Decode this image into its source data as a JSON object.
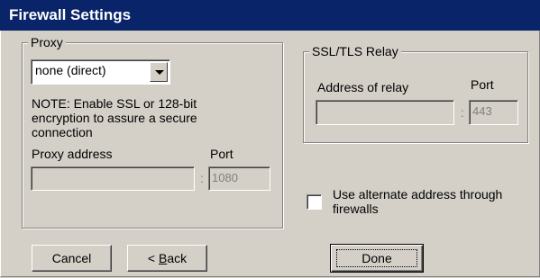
{
  "window": {
    "title": "Firewall Settings"
  },
  "proxy": {
    "legend": "Proxy",
    "mode_selected": "none (direct)",
    "note": "NOTE: Enable SSL or 128-bit encryption to assure a secure connection",
    "address_label": "Proxy address",
    "address_value": "",
    "port_label": "Port",
    "port_value": "1080",
    "separator": ":"
  },
  "relay": {
    "legend": "SSL/TLS Relay",
    "address_label": "Address of relay",
    "address_value": "",
    "port_label": "Port",
    "port_value": "443",
    "separator": ":"
  },
  "alternate": {
    "label": "Use alternate address through firewalls",
    "checked": false
  },
  "buttons": {
    "cancel": "Cancel",
    "back_prefix": "< ",
    "back_accel": "B",
    "back_rest": "ack",
    "done": "Done"
  }
}
